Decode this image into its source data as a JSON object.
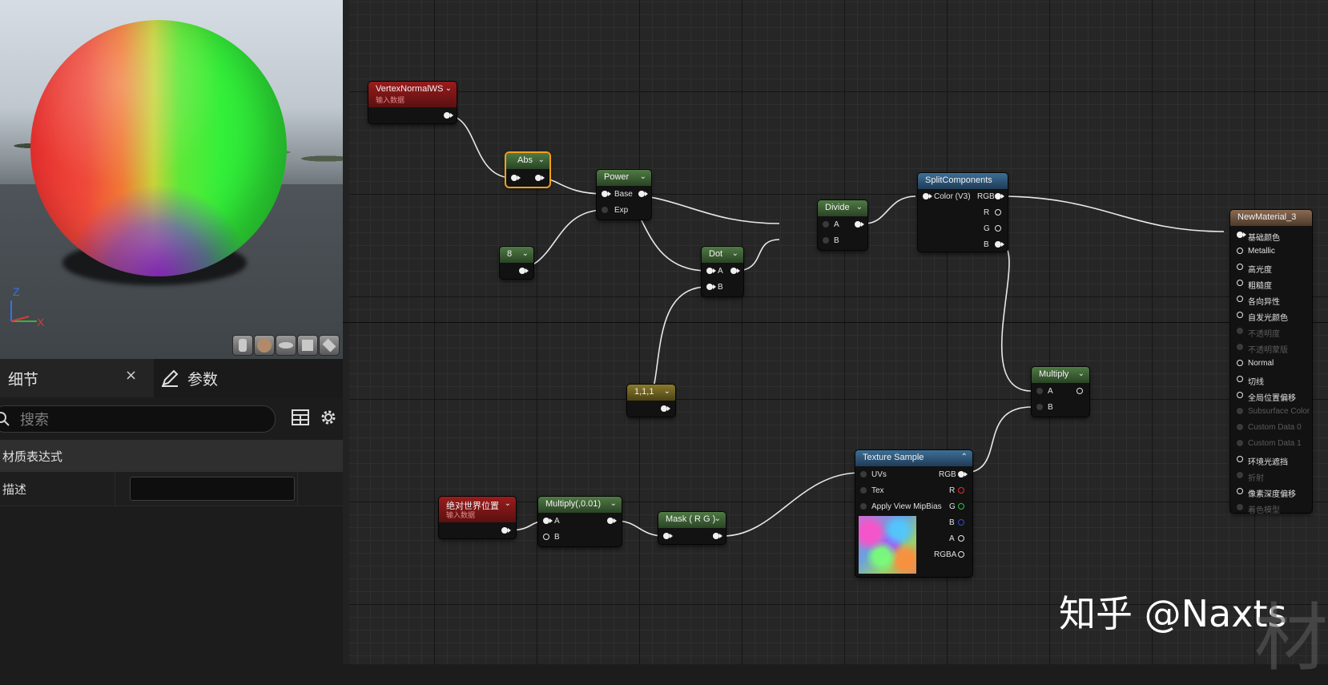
{
  "details_panel": {
    "tab_details": "细节",
    "tab_close": "×",
    "tab_params": "参数",
    "search_placeholder": "搜索",
    "section_header": "材质表达式",
    "desc_label": "描述",
    "desc_value": ""
  },
  "viewport": {
    "axis_z": "Z",
    "axis_x": "X"
  },
  "nodes": {
    "vertex_normal": {
      "title": "VertexNormalWS",
      "subtitle": "输入数据"
    },
    "abs": {
      "title": "Abs"
    },
    "power": {
      "title": "Power",
      "pin_base": "Base",
      "pin_exp": "Exp"
    },
    "const8": {
      "title": "8"
    },
    "dot": {
      "title": "Dot",
      "pin_a": "A",
      "pin_b": "B"
    },
    "const111": {
      "title": "1,1,1"
    },
    "divide": {
      "title": "Divide",
      "pin_a": "A",
      "pin_b": "B"
    },
    "split": {
      "title": "SplitComponents",
      "pin_in": "Color (V3)",
      "out_rgb": "RGB",
      "out_r": "R",
      "out_g": "G",
      "out_b": "B"
    },
    "multiply": {
      "title": "Multiply",
      "pin_a": "A",
      "pin_b": "B"
    },
    "world_pos": {
      "title": "绝对世界位置",
      "subtitle": "输入数据"
    },
    "multiply001": {
      "title": "Multiply(,0.01)",
      "pin_a": "A",
      "pin_b": "B"
    },
    "mask": {
      "title": "Mask ( R G )"
    },
    "texture": {
      "title": "Texture Sample",
      "pin_uvs": "UVs",
      "pin_tex": "Tex",
      "pin_mip": "Apply View MipBias",
      "out_rgb": "RGB",
      "out_r": "R",
      "out_g": "G",
      "out_b": "B",
      "out_a": "A",
      "out_rgba": "RGBA"
    },
    "material": {
      "title": "NewMaterial_3",
      "pins": [
        "基础颜色",
        "Metallic",
        "高光度",
        "粗糙度",
        "各向异性",
        "自发光颜色",
        "不透明度",
        "不透明蒙版",
        "Normal",
        "切线",
        "全局位置偏移",
        "Subsurface Color",
        "Custom Data 0",
        "Custom Data 1",
        "环境光遮挡",
        "折射",
        "像素深度偏移",
        "着色模型"
      ]
    }
  },
  "watermark": {
    "text": "知乎 @Naxts",
    "faint": "材"
  },
  "colors": {
    "selection": "#f0a21a",
    "node_green": "#4f7a44",
    "node_red": "#9a1c1c",
    "node_blue": "#3e6f96"
  }
}
